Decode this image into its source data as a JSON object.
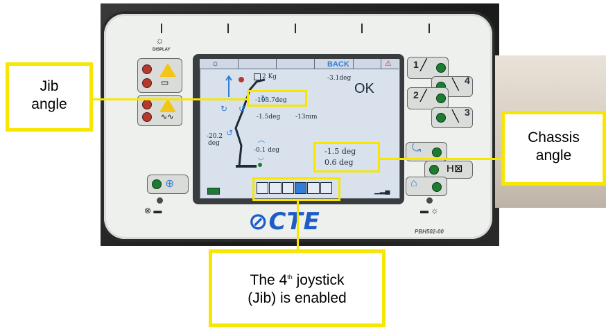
{
  "panel": {
    "display_label": "DISPLAY",
    "back_label": "BACK",
    "model_code": "PBH502-00",
    "brand_logo": "CTE"
  },
  "screen": {
    "load": "2 Kg",
    "tilt": "-3.1deg",
    "status": "OK",
    "jib_angle": "-103.7deg",
    "boom_angle": "-1.5deg",
    "boom_extension": "-13mm",
    "left_angle_value": "-20.2",
    "left_angle_unit": "deg",
    "base_angle": "-0.1 deg",
    "chassis_x": "-1.5 deg",
    "chassis_y": "0.6 deg",
    "joystick_cells": 6,
    "active_joystick_index": 4
  },
  "joysticks": {
    "j1": "1",
    "j2": "2",
    "j3": "3",
    "j4": "4"
  },
  "callouts": {
    "jib": {
      "line1": "Jib",
      "line2": "angle"
    },
    "chassis": {
      "line1": "Chassis",
      "line2": "angle"
    },
    "joystick": {
      "prefix": "The 4",
      "superscript": "th",
      "suffix": " joystick",
      "line2": "(Jib) is enabled"
    }
  },
  "colors": {
    "callout_yellow": "#f6e600",
    "screen_bg": "#d9e2ec",
    "active_cell": "#2f7fd9",
    "led_green": "#1c7d32",
    "led_red": "#b43a2f",
    "logo_blue": "#1e5dc8"
  },
  "icons": [
    "sun-icon",
    "warning-icon",
    "wheel-icon",
    "joystick-icon",
    "alarm-icon",
    "battery-icon",
    "home-icon",
    "truck-icon"
  ]
}
